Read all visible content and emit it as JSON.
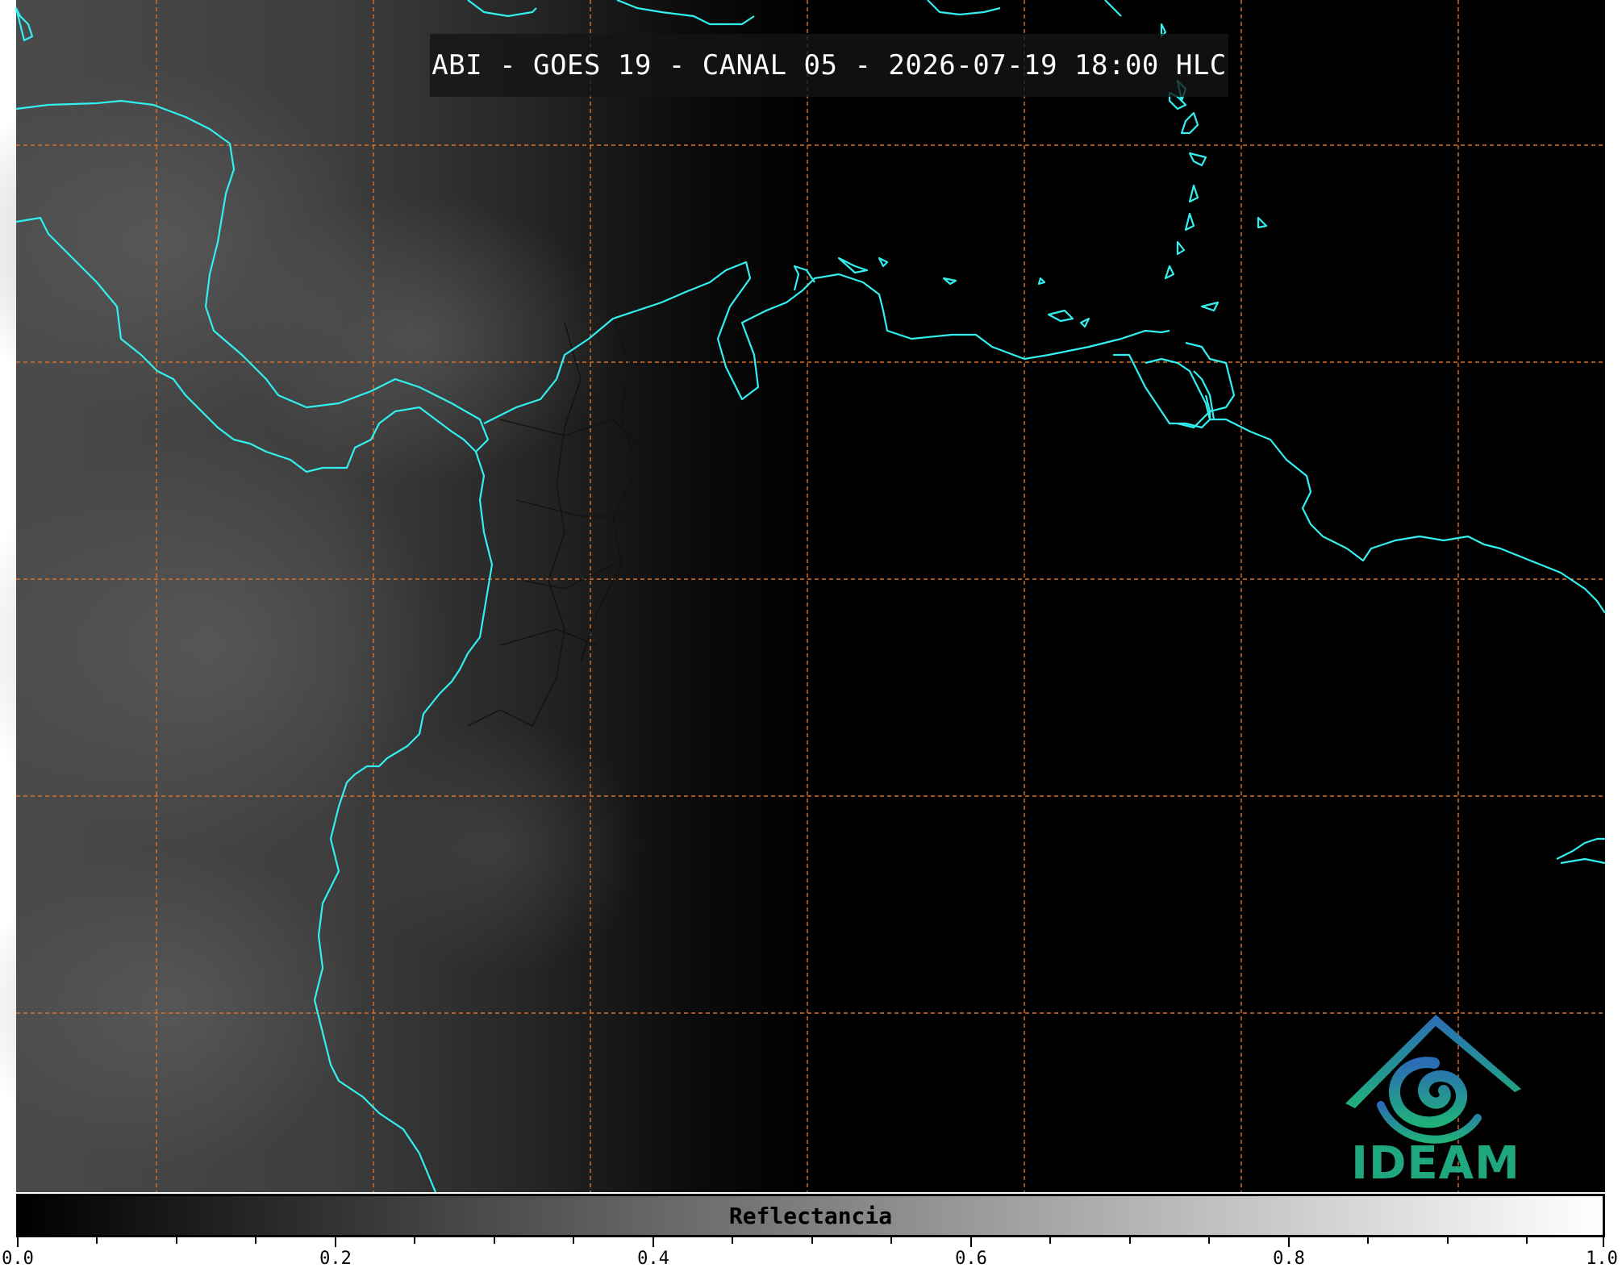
{
  "title": "ABI - GOES 19 - CANAL 05 - 2026-07-19 18:00 HLC",
  "logo": {
    "text": "IDEAM",
    "icon": "ideam-logo-icon",
    "color": "#1fa77f"
  },
  "colorbar": {
    "label": "Reflectancia",
    "ticks": [
      "0.0",
      "0.2",
      "0.4",
      "0.6",
      "0.8",
      "1.0"
    ],
    "range": [
      0.0,
      1.0
    ],
    "colormap": [
      "#000000",
      "#ffffff"
    ]
  },
  "colors": {
    "coastline": "#33f0f0",
    "gridlines": "#d9732a",
    "borders": "#111111"
  }
}
